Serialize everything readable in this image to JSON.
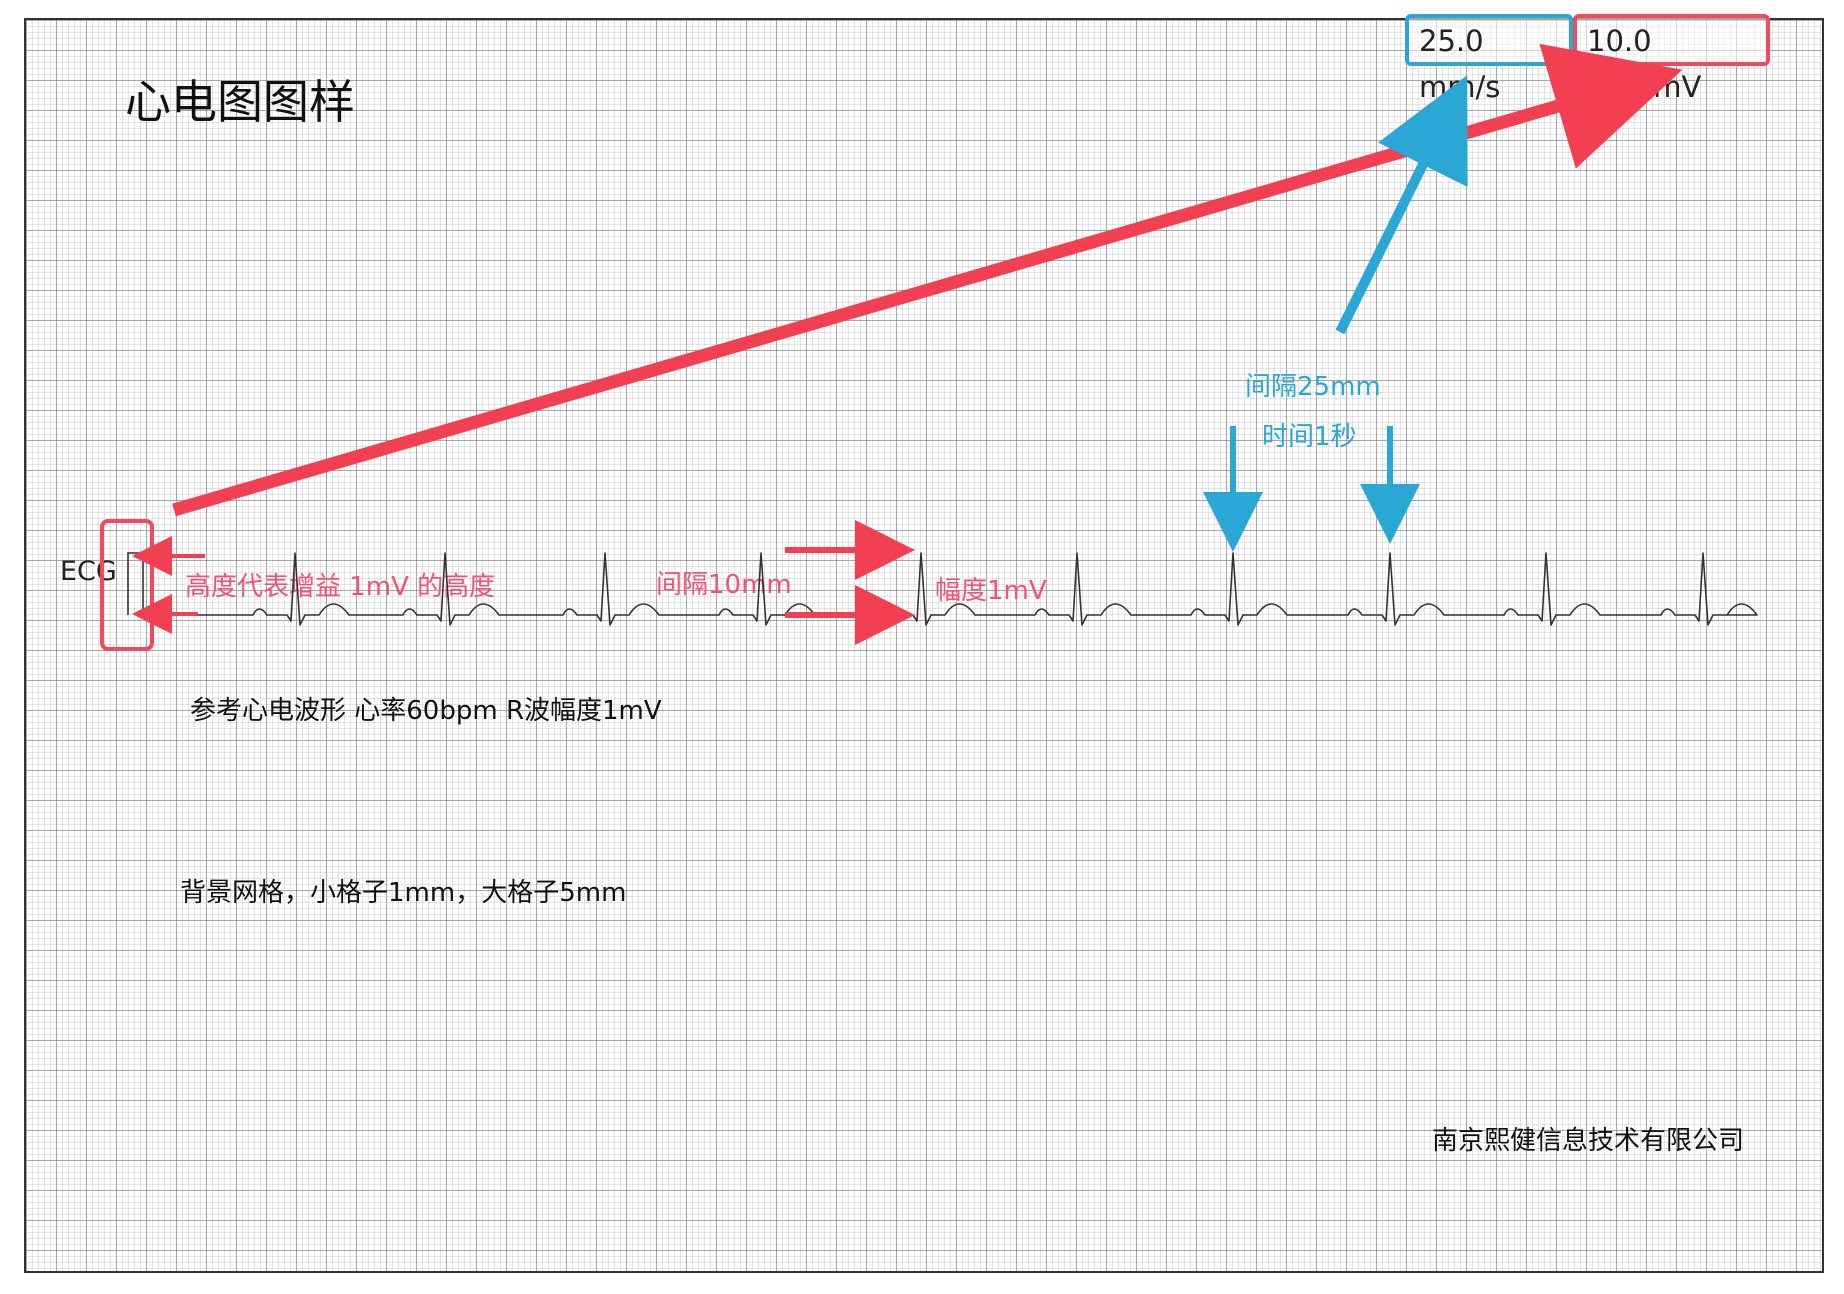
{
  "page": {
    "title": "心电图图样",
    "lead_label": "ECG",
    "paper_speed": "25.0 mm/s",
    "gain": "10.0 mm/mV"
  },
  "annotations": {
    "calibration_height": "高度代表增益 1mV 的高度",
    "interval_10mm": "间隔10mm",
    "amplitude": "幅度1mV",
    "interval_25mm": "间隔25mm",
    "time_1s": "时间1秒"
  },
  "notes": {
    "reference_waveform": "参考心电波形 心率60bpm R波幅度1mV",
    "grid_description": "背景网格，小格子1mm，大格子5mm",
    "company": "南京熙健信息技术有限公司"
  },
  "colors": {
    "annotation_pink": "#f1527a",
    "arrow_red": "#f23f52",
    "annotation_blue": "#2aa7d4",
    "trace": "#333333"
  }
}
